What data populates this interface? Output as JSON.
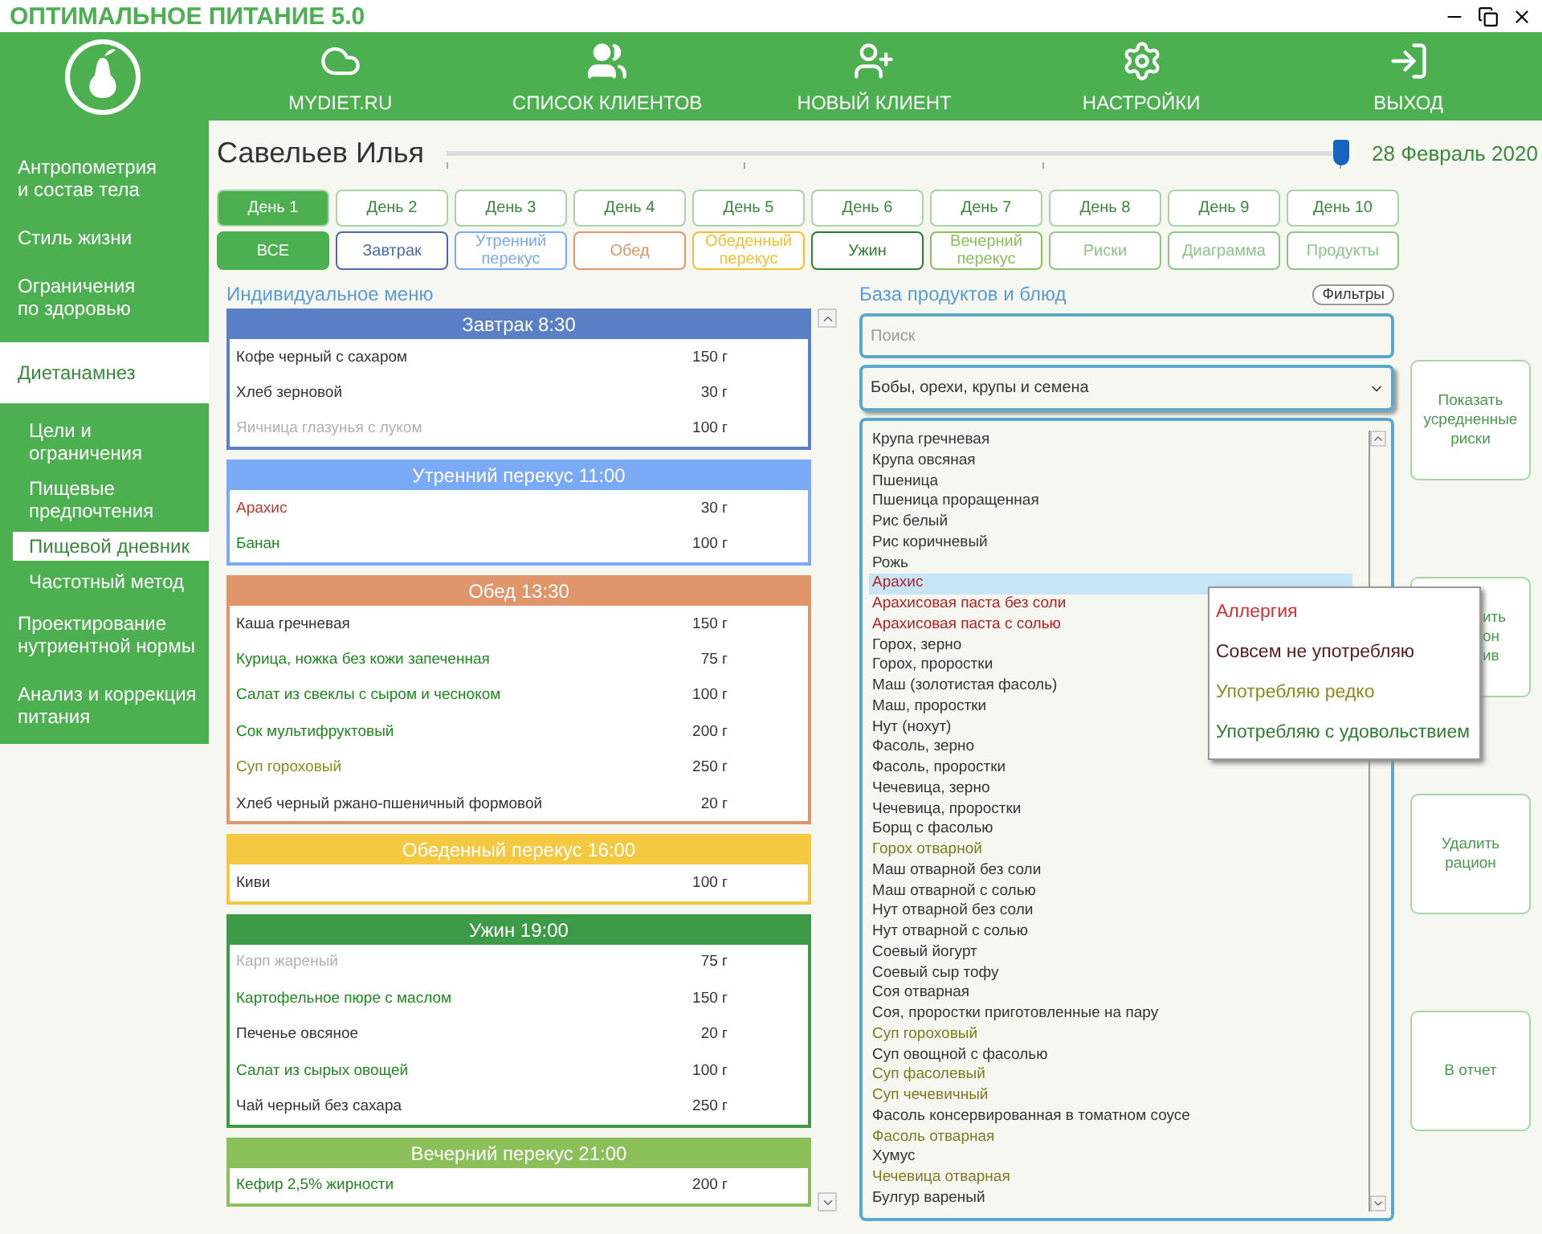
{
  "window": {
    "title": "ОПТИМАЛЬНОЕ ПИТАНИЕ 5.0"
  },
  "nav": [
    {
      "label": "MYDIET.RU",
      "kind": "cloud"
    },
    {
      "label": "СПИСОК КЛИЕНТОВ",
      "kind": "users"
    },
    {
      "label": "НОВЫЙ КЛИЕНТ",
      "kind": "adduser"
    },
    {
      "label": "НАСТРОЙКИ",
      "kind": "gear"
    },
    {
      "label": "ВЫХОД",
      "kind": "exit"
    }
  ],
  "sidebar": {
    "items": [
      {
        "label": "Антропометрия\nи состав тела",
        "selected": false
      },
      {
        "label": "Стиль жизни",
        "selected": false
      },
      {
        "label": "Ограничения\nпо здоровью",
        "selected": false
      },
      {
        "label": "Диетанамнез",
        "selected": true,
        "children": [
          {
            "label": "Цели и\nограничения",
            "selected": false
          },
          {
            "label": "Пищевые\nпредпочтения",
            "selected": false
          },
          {
            "label": "Пищевой дневник",
            "selected": true
          },
          {
            "label": "Частотный метод",
            "selected": false
          }
        ]
      },
      {
        "label": "Проектирование\nнутриентной нормы",
        "selected": false
      },
      {
        "label": "Анализ и коррекция\nпитания",
        "selected": false
      }
    ]
  },
  "client": {
    "name": "Савельев Илья",
    "date": "28 Февраль 2020",
    "timeline": {
      "level": 1
    }
  },
  "day_tabs": [
    {
      "label": "День 1",
      "selected": true
    },
    {
      "label": "День 2",
      "selected": false
    },
    {
      "label": "День 3",
      "selected": false
    },
    {
      "label": "День 4",
      "selected": false
    },
    {
      "label": "День 5",
      "selected": false
    },
    {
      "label": "День 6",
      "selected": false
    },
    {
      "label": "День 7",
      "selected": false
    },
    {
      "label": "День 8",
      "selected": false
    },
    {
      "label": "День 9",
      "selected": false
    },
    {
      "label": "День 10",
      "selected": false
    }
  ],
  "view_tabs": [
    {
      "label": "ВСЕ",
      "selected": true,
      "color": "#4caf50"
    },
    {
      "label": "Завтрак",
      "selected": false,
      "color": "#4a6bb0"
    },
    {
      "label": "Утренний\nперекус",
      "selected": false,
      "color": "#7aaaf5"
    },
    {
      "label": "Обед",
      "selected": false,
      "color": "#e0956a"
    },
    {
      "label": "Обеденный\nперекус",
      "selected": false,
      "color": "#f0c030"
    },
    {
      "label": "Ужин",
      "selected": false,
      "color": "#2e7d32"
    },
    {
      "label": "Вечерний\nперекус",
      "selected": false,
      "color": "#8bbf5a"
    },
    {
      "label": "Риски",
      "selected": false,
      "color": "#8cc48c"
    },
    {
      "label": "Диаграмма",
      "selected": false,
      "color": "#8cc48c"
    },
    {
      "label": "Продукты",
      "selected": false,
      "color": "#8cc48c"
    }
  ],
  "menu": {
    "title": "Индивидуальное меню",
    "meals": [
      {
        "title": "Завтрак 8:30",
        "color": "#5b7fc7",
        "items": [
          {
            "name": "Кофе черный с сахаром",
            "amount": "150 г",
            "color": "#333333"
          },
          {
            "name": "Хлеб зерновой",
            "amount": "30 г",
            "color": "#333333"
          },
          {
            "name": "Яичница глазунья с луком",
            "amount": "100 г",
            "color": "#b0b0b0"
          }
        ]
      },
      {
        "title": "Утренний перекус 11:00",
        "color": "#7aaaf5",
        "items": [
          {
            "name": "Арахис",
            "amount": "30 г",
            "color": "#c0392b"
          },
          {
            "name": "Банан",
            "amount": "100 г",
            "color": "#1e8a1e"
          }
        ]
      },
      {
        "title": "Обед 13:30",
        "color": "#e0956a",
        "items": [
          {
            "name": "Каша гречневая",
            "amount": "150 г",
            "color": "#333333"
          },
          {
            "name": "Курица, ножка без кожи запеченная",
            "amount": "75 г",
            "color": "#1e8a1e"
          },
          {
            "name": "Салат из свеклы с сыром и чесноком",
            "amount": "100 г",
            "color": "#1e8a1e"
          },
          {
            "name": "Сок мультифруктовый",
            "amount": "200 г",
            "color": "#1e8a1e"
          },
          {
            "name": "Суп гороховый",
            "amount": "250 г",
            "color": "#8a8a20"
          },
          {
            "name": "Хлеб черный ржано-пшеничный формовой",
            "amount": "20 г",
            "color": "#333333"
          }
        ]
      },
      {
        "title": "Обеденный перекус 16:00",
        "color": "#f5c842",
        "items": [
          {
            "name": "Киви",
            "amount": "100 г",
            "color": "#333333"
          }
        ]
      },
      {
        "title": "Ужин 19:00",
        "color": "#3d9a47",
        "items": [
          {
            "name": "Карп жареный",
            "amount": "75 г",
            "color": "#b0b0b0"
          },
          {
            "name": "Картофельное пюре с маслом",
            "amount": "150 г",
            "color": "#1e8a1e"
          },
          {
            "name": "Печенье овсяное",
            "amount": "20 г",
            "color": "#333333"
          },
          {
            "name": "Салат из сырых овощей",
            "amount": "100 г",
            "color": "#1e8a1e"
          },
          {
            "name": "Чай черный без сахара",
            "amount": "250 г",
            "color": "#333333"
          }
        ]
      },
      {
        "title": "Вечерний перекус 21:00",
        "color": "#8bbf5a",
        "items": [
          {
            "name": "Кефир 2,5% жирности",
            "amount": "200 г",
            "color": "#1e8a1e"
          }
        ]
      }
    ]
  },
  "database": {
    "title": "База продуктов и блюд",
    "filter_button": "Фильтры",
    "search": {
      "placeholder": "Поиск"
    },
    "category": {
      "value": "Бобы, орехи, крупы и семена"
    },
    "items": [
      {
        "name": "Крупа гречневая",
        "color": "#333333",
        "selected": false
      },
      {
        "name": "Крупа овсяная",
        "color": "#333333",
        "selected": false
      },
      {
        "name": "Пшеница",
        "color": "#333333",
        "selected": false
      },
      {
        "name": "Пшеница проращенная",
        "color": "#333333",
        "selected": false
      },
      {
        "name": "Рис белый",
        "color": "#333333",
        "selected": false
      },
      {
        "name": "Рис коричневый",
        "color": "#333333",
        "selected": false
      },
      {
        "name": "Рожь",
        "color": "#333333",
        "selected": false
      },
      {
        "name": "Арахис",
        "color": "#b22222",
        "selected": true
      },
      {
        "name": "Арахисовая паста без соли",
        "color": "#b22222",
        "selected": false
      },
      {
        "name": "Арахисовая паста с солью",
        "color": "#b22222",
        "selected": false
      },
      {
        "name": "Горох, зерно",
        "color": "#333333",
        "selected": false
      },
      {
        "name": "Горох, проростки",
        "color": "#333333",
        "selected": false
      },
      {
        "name": "Маш (золотистая фасоль)",
        "color": "#333333",
        "selected": false
      },
      {
        "name": "Маш, проростки",
        "color": "#333333",
        "selected": false
      },
      {
        "name": "Нут (нохут)",
        "color": "#333333",
        "selected": false
      },
      {
        "name": "Фасоль, зерно",
        "color": "#333333",
        "selected": false
      },
      {
        "name": "Фасоль, проростки",
        "color": "#333333",
        "selected": false
      },
      {
        "name": "Чечевица, зерно",
        "color": "#333333",
        "selected": false
      },
      {
        "name": "Чечевица, проростки",
        "color": "#333333",
        "selected": false
      },
      {
        "name": "Борщ с фасолью",
        "color": "#333333",
        "selected": false
      },
      {
        "name": "Горох отварной",
        "color": "#7a7a20",
        "selected": false
      },
      {
        "name": "Маш отварной без соли",
        "color": "#333333",
        "selected": false
      },
      {
        "name": "Маш отварной с солью",
        "color": "#333333",
        "selected": false
      },
      {
        "name": "Нут отварной без соли",
        "color": "#333333",
        "selected": false
      },
      {
        "name": "Нут отварной с солью",
        "color": "#333333",
        "selected": false
      },
      {
        "name": "Соевый йогурт",
        "color": "#333333",
        "selected": false
      },
      {
        "name": "Соевый сыр тофу",
        "color": "#333333",
        "selected": false
      },
      {
        "name": "Соя отварная",
        "color": "#333333",
        "selected": false
      },
      {
        "name": "Соя, проростки приготовленные на пару",
        "color": "#333333",
        "selected": false
      },
      {
        "name": "Суп гороховый",
        "color": "#7a7a20",
        "selected": false
      },
      {
        "name": "Суп овощной с фасолью",
        "color": "#333333",
        "selected": false
      },
      {
        "name": "Суп фасолевый",
        "color": "#7a7a20",
        "selected": false
      },
      {
        "name": "Суп чечевичный",
        "color": "#7a7a20",
        "selected": false
      },
      {
        "name": "Фасоль консервированная в томатном соусе",
        "color": "#333333",
        "selected": false
      },
      {
        "name": "Фасоль отварная",
        "color": "#7a7a20",
        "selected": false
      },
      {
        "name": "Хумус",
        "color": "#333333",
        "selected": false
      },
      {
        "name": "Чечевица отварная",
        "color": "#7a7a20",
        "selected": false
      },
      {
        "name": "Булгур вареный",
        "color": "#333333",
        "selected": false
      }
    ]
  },
  "context_menu": [
    {
      "label": "Аллергия",
      "color": "#cc3333"
    },
    {
      "label": "Совсем не употребляю",
      "color": "#5a1a1a"
    },
    {
      "label": "Употребляю редко",
      "color": "#8a8a20"
    },
    {
      "label": "Употребляю с удовольствием",
      "color": "#2e7d32"
    }
  ],
  "actions": [
    {
      "label": "Показать\nусредненные\nриски",
      "kind": "full"
    },
    {
      "label": "ить\nон\nив",
      "kind": "covered"
    },
    {
      "label": "Удалить\nрацион",
      "kind": "full"
    },
    {
      "label": "В отчет",
      "kind": "full"
    }
  ]
}
